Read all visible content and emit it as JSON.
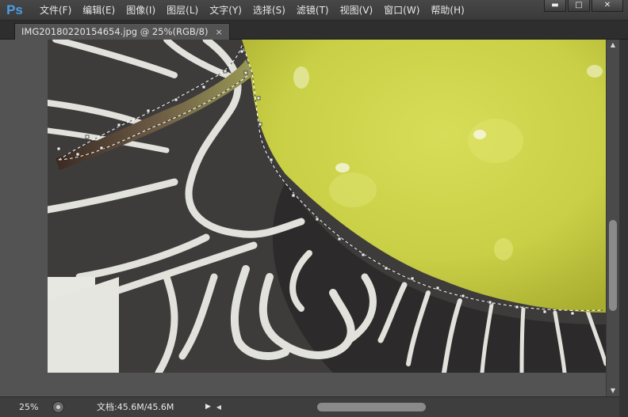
{
  "app": {
    "logo_text": "Ps",
    "accent": "#4b9ee8"
  },
  "menu": {
    "items": [
      {
        "label": "文件(F)"
      },
      {
        "label": "编辑(E)"
      },
      {
        "label": "图像(I)"
      },
      {
        "label": "图层(L)"
      },
      {
        "label": "文字(Y)"
      },
      {
        "label": "选择(S)"
      },
      {
        "label": "滤镜(T)"
      },
      {
        "label": "视图(V)"
      },
      {
        "label": "窗口(W)"
      },
      {
        "label": "帮助(H)"
      }
    ]
  },
  "window_controls": {
    "minimize": "▬",
    "maximize": "□",
    "close": "✕"
  },
  "document_tab": {
    "title": "IMG20180220154654.jpg @ 25%(RGB/8)",
    "close": "×"
  },
  "status_bar": {
    "zoom": "25%",
    "doc_info": "文档:45.6M/45.6M",
    "menu_arrow": "▶"
  },
  "scrollbars": {
    "up_arrow": "▲",
    "down_arrow": "▼",
    "left_arrow": "◀"
  },
  "icons": {
    "status_icon": "status-info-icon",
    "selection": "marching-ants-selection"
  },
  "canvas": {
    "pear_color": "#cdd54a",
    "background_color": "#3c3a3a",
    "pattern_color": "#e2e2dc"
  }
}
